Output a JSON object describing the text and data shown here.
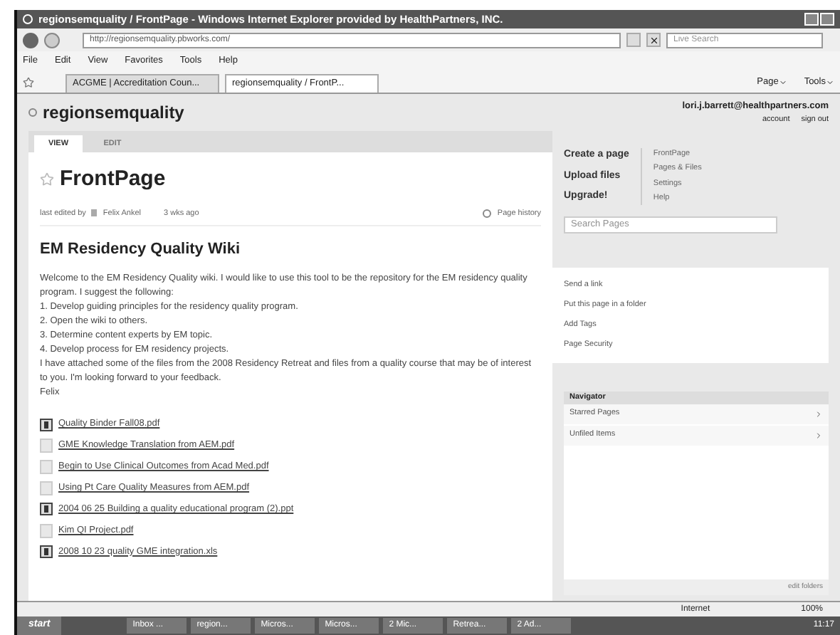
{
  "window": {
    "title": "regionsemquality / FrontPage - Windows Internet Explorer provided by HealthPartners, INC."
  },
  "address_bar": {
    "url": "http://regionsemquality.pbworks.com/",
    "search_placeholder": "Live Search"
  },
  "menu": [
    "File",
    "Edit",
    "View",
    "Favorites",
    "Tools",
    "Help"
  ],
  "browser_tabs": [
    {
      "label": "ACGME | Accreditation Coun...",
      "selected": false
    },
    {
      "label": "regionsemquality / FrontP...",
      "selected": true
    }
  ],
  "command_bar": [
    "Page",
    "Tools"
  ],
  "site": {
    "name": "regionsemquality",
    "user": "lori.j.barrett@healthpartners.com",
    "links": [
      "account",
      "sign out"
    ]
  },
  "page_tabs": [
    {
      "label": "VIEW",
      "selected": true
    },
    {
      "label": "EDIT",
      "selected": false
    }
  ],
  "page": {
    "title": "FrontPage",
    "edited_by": "last edited by",
    "author": "Felix Ankel",
    "age": "3 wks ago",
    "history": "Page history",
    "heading": "EM Residency Quality Wiki",
    "lines": [
      "Welcome to the EM Residency Quality wiki. I would like to use this tool to be the repository for the EM residency quality program. I suggest the following:",
      "1. Develop guiding principles for the residency quality program.",
      "2. Open the wiki to others.",
      "3. Determine content experts by EM topic.",
      "4. Develop process for EM residency projects.",
      "I have attached some of the files from the 2008 Residency Retreat and files from a quality course that may be of interest to you. I'm looking forward to your feedback.",
      "Felix"
    ],
    "files": [
      {
        "name": "Quality Binder Fall08.pdf",
        "kind": "unknown"
      },
      {
        "name": "GME Knowledge Translation from AEM.pdf",
        "kind": "doc"
      },
      {
        "name": "Begin to Use Clinical Outcomes from Acad Med.pdf",
        "kind": "doc"
      },
      {
        "name": "Using Pt Care Quality Measures from AEM.pdf",
        "kind": "doc"
      },
      {
        "name": "2004 06 25 Building a quality educational program (2).ppt",
        "kind": "unknown"
      },
      {
        "name": "Kim QI Project.pdf",
        "kind": "doc"
      },
      {
        "name": "2008 10 23 quality GME integration.xls",
        "kind": "unknown"
      }
    ]
  },
  "sidebar": {
    "actions": [
      "Create a page",
      "Upload files",
      "Upgrade!"
    ],
    "links": [
      "FrontPage",
      "Pages & Files",
      "Settings",
      "Help"
    ],
    "search_placeholder": "Search Pages",
    "page_actions": [
      "Send a link",
      "Put this page in a folder",
      "Add Tags",
      "Page Security"
    ],
    "navigator": {
      "title": "Navigator",
      "items": [
        "Starred Pages",
        "Unfiled Items"
      ],
      "footer": "edit folders"
    }
  },
  "status_bar": {
    "zone": "Internet",
    "zoom": "100%"
  },
  "taskbar": {
    "start": "start",
    "items": [
      "Inbox ...",
      "region...",
      "Micros...",
      "Micros...",
      "2 Mic...",
      "Retrea...",
      "2 Ad..."
    ],
    "clock": "11:17"
  }
}
